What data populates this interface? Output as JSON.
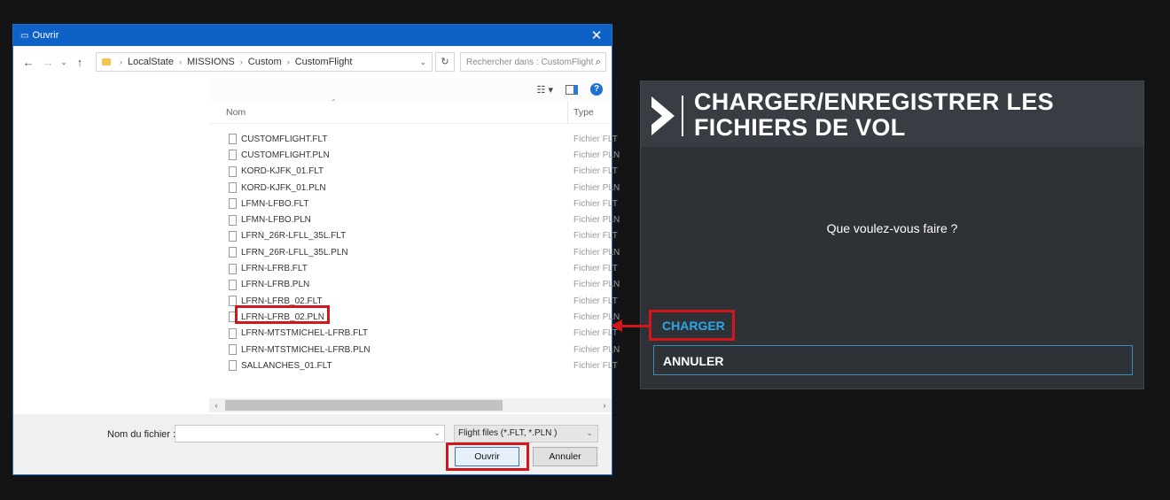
{
  "dialog": {
    "title": "Ouvrir",
    "close": "✕",
    "nav": {
      "back": "←",
      "forward": "→",
      "recent": "⌄",
      "up": "↑"
    },
    "breadcrumb": [
      "LocalState",
      "MISSIONS",
      "Custom",
      "CustomFlight"
    ],
    "breadcrumb_sep": "›",
    "address_chevron": "⌄",
    "refresh": "↻",
    "search_placeholder": "Rechercher dans : CustomFlight",
    "search_icon": "⌕",
    "view_icon": "☷ ▾",
    "help": "?",
    "columns": {
      "name": "Nom",
      "type": "Type",
      "sort_indicator": "⌃"
    },
    "files": [
      {
        "name": "CUSTOMFLIGHT.FLT",
        "type": "Fichier FLT"
      },
      {
        "name": "CUSTOMFLIGHT.PLN",
        "type": "Fichier PLN"
      },
      {
        "name": "KORD-KJFK_01.FLT",
        "type": "Fichier FLT"
      },
      {
        "name": "KORD-KJFK_01.PLN",
        "type": "Fichier PLN"
      },
      {
        "name": "LFMN-LFBO.FLT",
        "type": "Fichier FLT"
      },
      {
        "name": "LFMN-LFBO.PLN",
        "type": "Fichier PLN"
      },
      {
        "name": "LFRN_26R-LFLL_35L.FLT",
        "type": "Fichier FLT"
      },
      {
        "name": "LFRN_26R-LFLL_35L.PLN",
        "type": "Fichier PLN"
      },
      {
        "name": "LFRN-LFRB.FLT",
        "type": "Fichier FLT"
      },
      {
        "name": "LFRN-LFRB.PLN",
        "type": "Fichier PLN"
      },
      {
        "name": "LFRN-LFRB_02.FLT",
        "type": "Fichier FLT"
      },
      {
        "name": "LFRN-LFRB_02.PLN",
        "type": "Fichier PLN"
      },
      {
        "name": "LFRN-MTSTMICHEL-LFRB.FLT",
        "type": "Fichier FLT"
      },
      {
        "name": "LFRN-MTSTMICHEL-LFRB.PLN",
        "type": "Fichier PLN"
      },
      {
        "name": "SALLANCHES_01.FLT",
        "type": "Fichier FLT"
      }
    ],
    "scroll": {
      "left": "‹",
      "right": "›"
    },
    "filename_label": "Nom du fichier :",
    "filename_value": "",
    "dropdown_chevron": "⌄",
    "filter": "Flight files (*.FLT, *.PLN )",
    "open_button": "Ouvrir",
    "cancel_button": "Annuler"
  },
  "panel": {
    "title": "CHARGER/ENREGISTRER LES FICHIERS DE VOL",
    "question": "Que voulez-vous faire ?",
    "load_button": "CHARGER",
    "cancel_button": "ANNULER"
  },
  "colors": {
    "highlight": "#d1161c",
    "accent_blue": "#2aa8e8",
    "titlebar": "#0e62c7"
  }
}
